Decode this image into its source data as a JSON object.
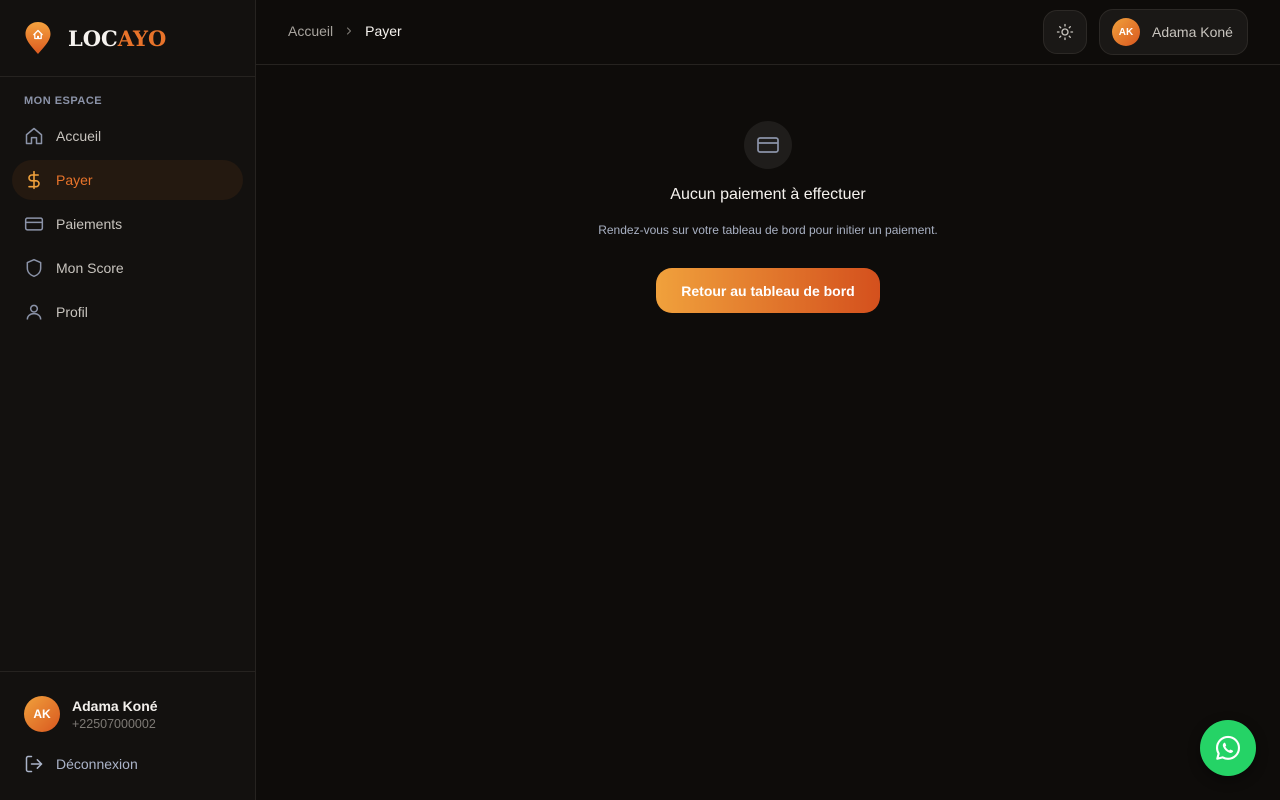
{
  "brand": {
    "part1": "LOC",
    "part2": "AYO",
    "accent": "#e8732a"
  },
  "sidebar": {
    "section_label": "MON ESPACE",
    "items": [
      {
        "label": "Accueil",
        "icon": "home-icon",
        "active": false
      },
      {
        "label": "Payer",
        "icon": "dollar-icon",
        "active": true
      },
      {
        "label": "Paiements",
        "icon": "credit-card-icon",
        "active": false
      },
      {
        "label": "Mon Score",
        "icon": "shield-icon",
        "active": false
      },
      {
        "label": "Profil",
        "icon": "user-icon",
        "active": false
      }
    ],
    "user": {
      "initials": "AK",
      "name": "Adama Koné",
      "phone": "+22507000002"
    },
    "logout_label": "Déconnexion"
  },
  "header": {
    "breadcrumb": {
      "home": "Accueil",
      "current": "Payer"
    },
    "user": {
      "initials": "AK",
      "name": "Adama Koné"
    }
  },
  "main": {
    "empty_title": "Aucun paiement à effectuer",
    "empty_subtitle": "Rendez-vous sur votre tableau de bord pour initier un paiement.",
    "cta_label": "Retour au tableau de bord"
  },
  "fab": {
    "icon": "whatsapp-icon",
    "color": "#25d366"
  }
}
